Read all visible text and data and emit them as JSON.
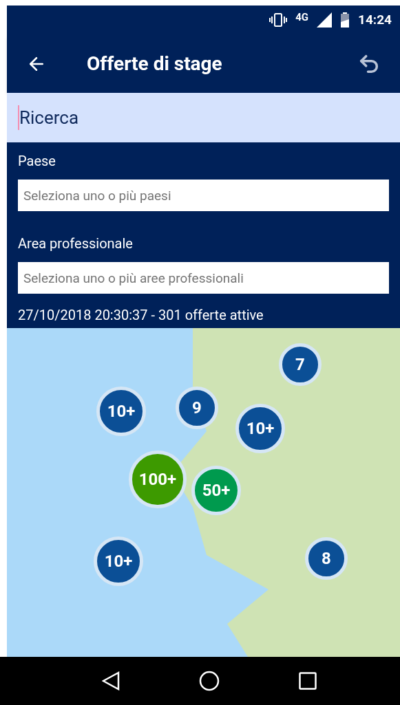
{
  "status_bar": {
    "network": "4G",
    "time": "14:24"
  },
  "app_bar": {
    "title": "Offerte di stage"
  },
  "search": {
    "value": "Ricerca"
  },
  "filters": [
    {
      "label": "Paese",
      "placeholder": "Seleziona uno o più paesi"
    },
    {
      "label": "Area professionale",
      "placeholder": "Seleziona uno o più aree professionali"
    }
  ],
  "summary": "27/10/2018 20:30:37 - 301 offerte attive",
  "map": {
    "markers": [
      {
        "label": "7",
        "color": "#0b4f96"
      },
      {
        "label": "10+",
        "color": "#0b4f96"
      },
      {
        "label": "9",
        "color": "#0b4f96"
      },
      {
        "label": "10+",
        "color": "#0b4f96"
      },
      {
        "label": "100+",
        "color": "#3d9a00"
      },
      {
        "label": "50+",
        "color": "#009a4e"
      },
      {
        "label": "10+",
        "color": "#0b4f96"
      },
      {
        "label": "8",
        "color": "#0b4f96"
      }
    ]
  }
}
